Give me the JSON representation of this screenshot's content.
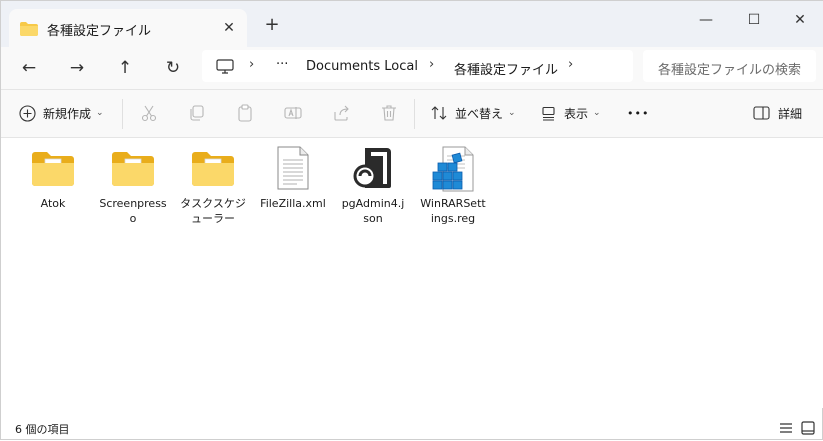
{
  "tab": {
    "title": "各種設定ファイル",
    "close": "✕",
    "new_tab": "+"
  },
  "window_controls": {
    "minimize": "—",
    "maximize": "☐",
    "close": "✕"
  },
  "nav": {
    "back": "←",
    "forward": "→",
    "up": "↑",
    "refresh": "↻"
  },
  "address": {
    "more": "···",
    "crumbs": [
      "Documents Local",
      "各種設定ファイル"
    ],
    "sep": "›"
  },
  "search": {
    "placeholder": "各種設定ファイルの検索"
  },
  "toolbar": {
    "new_label": "新規作成",
    "sort_label": "並べ替え",
    "view_label": "表示",
    "more": "•••",
    "details_label": "詳細"
  },
  "items": [
    {
      "name": "Atok",
      "type": "folder-icon"
    },
    {
      "name": "Screenpresso",
      "type": "folder-icon"
    },
    {
      "name": "タスクスケジューラー",
      "type": "folder-icon"
    },
    {
      "name": "FileZilla.xml",
      "type": "document-icon"
    },
    {
      "name": "pgAdmin4.json",
      "type": "json-file-icon"
    },
    {
      "name": "WinRARSettings.reg",
      "type": "registry-file-icon"
    }
  ],
  "status": {
    "count_text": "6 個の項目"
  },
  "colors": {
    "folder": "#f7c948",
    "folder_dark": "#e9ad1b",
    "accent": "#0b5cad",
    "registry": "#1f8ad6"
  }
}
